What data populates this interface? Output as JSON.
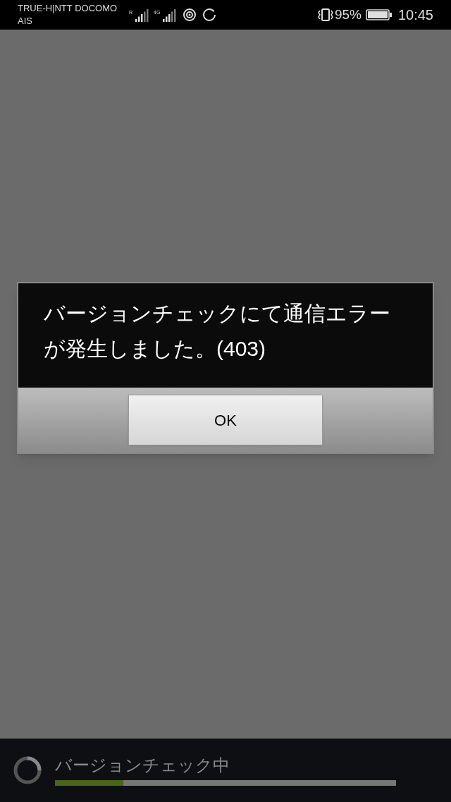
{
  "status_bar": {
    "carrier_line_1": "TRUE-H|NTT DOCOMO",
    "carrier_line_2": "AIS",
    "signal_1_label": "R",
    "signal_2_label": "4G",
    "battery_percent": "95%",
    "time": "10:45"
  },
  "dialog": {
    "message": "バージョンチェックにて通信エラーが発生しました。(403)",
    "button": "OK"
  },
  "progress": {
    "label": "バージョンチェック中",
    "level": 0.2
  }
}
